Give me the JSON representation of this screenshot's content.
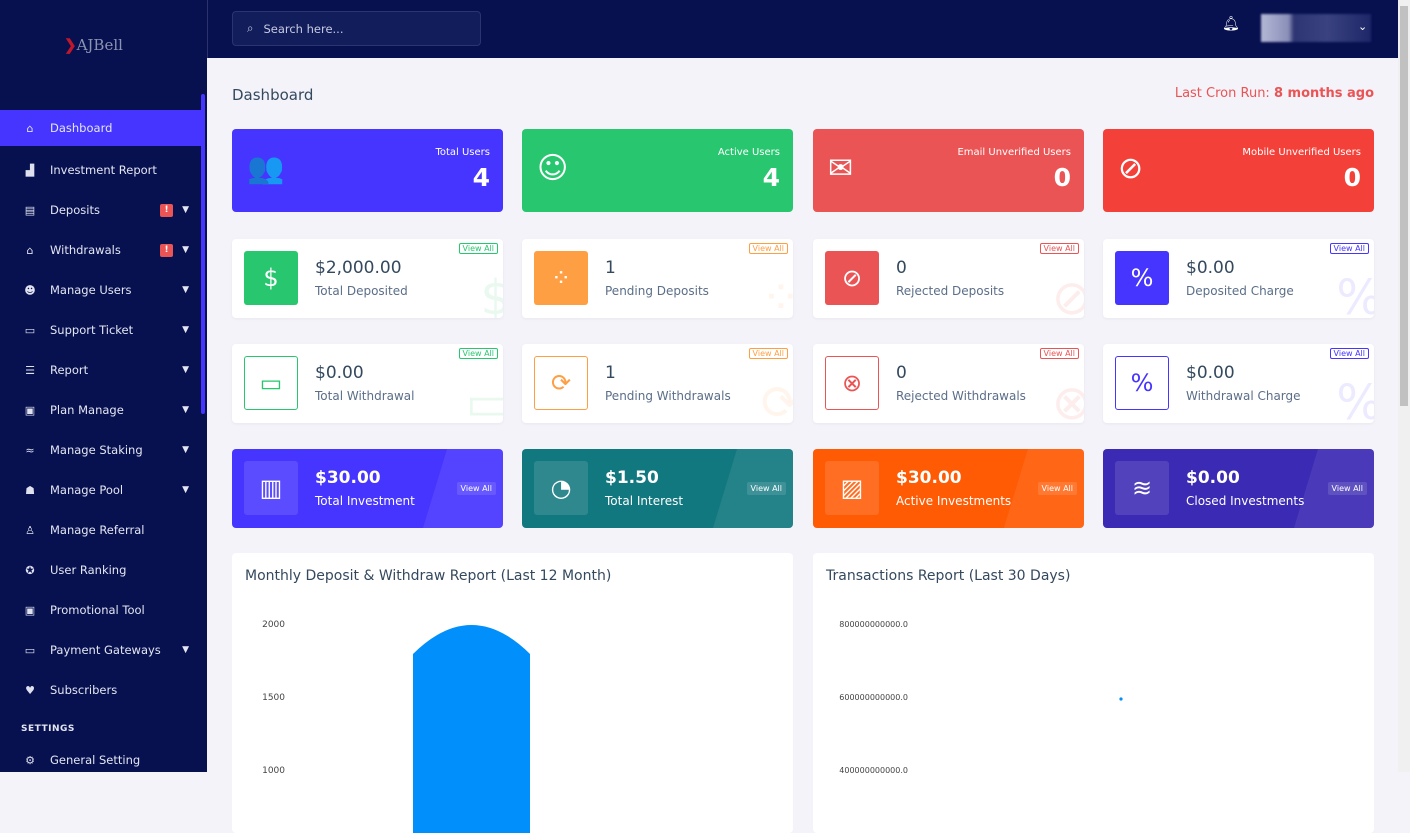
{
  "brand": {
    "logo": "AJBell"
  },
  "search": {
    "placeholder": "Search here..."
  },
  "sidebar": {
    "items": [
      {
        "label": "Dashboard",
        "icon": "home-icon",
        "glyph": "⌂",
        "active": true
      },
      {
        "label": "Investment Report",
        "icon": "bar-chart-icon",
        "glyph": "▟"
      },
      {
        "label": "Deposits",
        "icon": "deposit-icon",
        "glyph": "▤",
        "alert": "!",
        "chevron": true
      },
      {
        "label": "Withdrawals",
        "icon": "bank-icon",
        "glyph": "⌂",
        "alert": "!",
        "chevron": true
      },
      {
        "label": "Manage Users",
        "icon": "users-icon",
        "glyph": "☻",
        "chevron": true
      },
      {
        "label": "Support Ticket",
        "icon": "ticket-icon",
        "glyph": "▭",
        "chevron": true
      },
      {
        "label": "Report",
        "icon": "list-icon",
        "glyph": "☰",
        "chevron": true
      },
      {
        "label": "Plan Manage",
        "icon": "clipboard-icon",
        "glyph": "▣",
        "chevron": true
      },
      {
        "label": "Manage Staking",
        "icon": "staking-icon",
        "glyph": "≈",
        "chevron": true
      },
      {
        "label": "Manage Pool",
        "icon": "pool-icon",
        "glyph": "☗",
        "chevron": true
      },
      {
        "label": "Manage Referral",
        "icon": "referral-icon",
        "glyph": "♙"
      },
      {
        "label": "User Ranking",
        "icon": "medal-icon",
        "glyph": "✪"
      },
      {
        "label": "Promotional Tool",
        "icon": "promo-icon",
        "glyph": "▣"
      },
      {
        "label": "Payment Gateways",
        "icon": "credit-card-icon",
        "glyph": "▭",
        "chevron": true
      },
      {
        "label": "Subscribers",
        "icon": "thumbs-up-icon",
        "glyph": "♥"
      }
    ],
    "section": "SETTINGS",
    "settings_items": [
      {
        "label": "General Setting",
        "icon": "gear-icon",
        "glyph": "⚙"
      }
    ]
  },
  "page": {
    "title": "Dashboard",
    "cron_label": "Last Cron Run:",
    "cron_value": "8 months ago"
  },
  "row1": [
    {
      "label": "Total Users",
      "value": "4",
      "color": "#4634ff",
      "icon": "users-icon",
      "glyph": "👥"
    },
    {
      "label": "Active Users",
      "value": "4",
      "color": "#28c76f",
      "icon": "user-check-icon",
      "glyph": "☺"
    },
    {
      "label": "Email Unverified Users",
      "value": "0",
      "color": "#ea5455",
      "icon": "envelope-icon",
      "glyph": "✉"
    },
    {
      "label": "Mobile Unverified Users",
      "value": "0",
      "color": "#f3413a",
      "icon": "mobile-off-icon",
      "glyph": "⊘"
    }
  ],
  "row2": [
    {
      "value": "$2,000.00",
      "label": "Total Deposited",
      "color": "#28c76f",
      "icon": "hand-dollar-icon",
      "glyph": "$",
      "view": "View All"
    },
    {
      "value": "1",
      "label": "Pending Deposits",
      "color": "#ff9f43",
      "icon": "spinner-icon",
      "glyph": "⁘",
      "view": "View All"
    },
    {
      "value": "0",
      "label": "Rejected Deposits",
      "color": "#ea5455",
      "icon": "ban-icon",
      "glyph": "⊘",
      "view": "View All"
    },
    {
      "value": "$0.00",
      "label": "Deposited Charge",
      "color": "#4634ff",
      "icon": "percent-icon",
      "glyph": "%",
      "view": "View All"
    }
  ],
  "row3": [
    {
      "value": "$0.00",
      "label": "Total Withdrawal",
      "color": "#28c76f",
      "icon": "credit-card-icon",
      "glyph": "▭",
      "view": "View All"
    },
    {
      "value": "1",
      "label": "Pending Withdrawals",
      "color": "#ff9f43",
      "icon": "refresh-icon",
      "glyph": "⟳",
      "view": "View All"
    },
    {
      "value": "0",
      "label": "Rejected Withdrawals",
      "color": "#ea5455",
      "icon": "times-circle-icon",
      "glyph": "⊗",
      "view": "View All"
    },
    {
      "value": "$0.00",
      "label": "Withdrawal Charge",
      "color": "#4634ff",
      "icon": "percent-icon",
      "glyph": "%",
      "view": "View All"
    }
  ],
  "row4": [
    {
      "value": "$30.00",
      "label": "Total Investment",
      "color": "#4634ff",
      "icon": "bar-chart-icon",
      "glyph": "▥",
      "view": "View All"
    },
    {
      "value": "$1.50",
      "label": "Total Interest",
      "color": "#12787f",
      "icon": "pie-chart-icon",
      "glyph": "◔",
      "view": "View All"
    },
    {
      "value": "$30.00",
      "label": "Active Investments",
      "color": "#ff5b04",
      "icon": "area-chart-icon",
      "glyph": "▨",
      "view": "View All"
    },
    {
      "value": "$0.00",
      "label": "Closed Investments",
      "color": "#3b2ab3",
      "icon": "chart-line-icon",
      "glyph": "≋",
      "view": "View All"
    }
  ],
  "chart_data": [
    {
      "type": "bar",
      "title": "Monthly Deposit & Withdraw Report (Last 12 Month)",
      "y_ticks": [
        "2000",
        "1500",
        "1000"
      ],
      "ylim_visible": [
        1000,
        2000
      ],
      "values": [
        2000
      ],
      "color": "#008ffb"
    },
    {
      "type": "line",
      "title": "Transactions Report (Last 30 Days)",
      "y_ticks": [
        "800000000000.0",
        "600000000000.0",
        "400000000000.0"
      ],
      "ylim_visible": [
        400000000000,
        800000000000
      ],
      "values": [
        600000000000
      ],
      "color": "#008ffb"
    }
  ]
}
